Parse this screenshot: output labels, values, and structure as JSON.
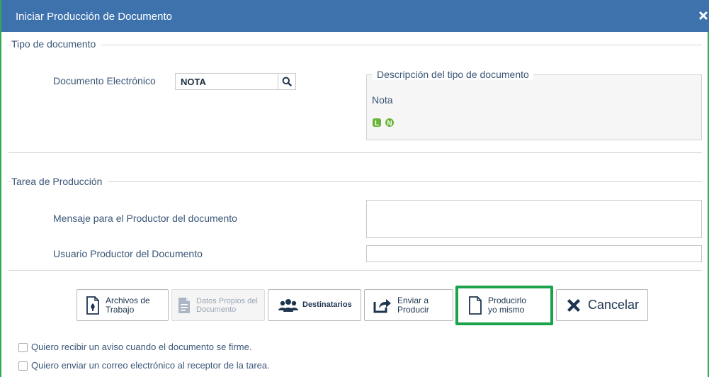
{
  "dialog": {
    "title": "Iniciar Producción de Documento",
    "close_icon": "close-icon"
  },
  "tipo_section": {
    "legend": "Tipo de documento",
    "doc_label": "Documento Electrónico",
    "doc_value": "NOTA",
    "search_icon": "search-icon",
    "desc_legend": "Descripción del tipo de documento",
    "desc_value": "Nota",
    "icons": [
      "libre-icon",
      "numerado-icon"
    ]
  },
  "tarea_section": {
    "legend": "Tarea de Producción",
    "mensaje_label": "Mensaje para el Productor del documento",
    "mensaje_value": "",
    "usuario_label": "Usuario Productor del Documento",
    "usuario_value": ""
  },
  "buttons": {
    "archivos_line1": "Archivos de",
    "archivos_line2": "Trabajo",
    "datos_line1": "Datos Propios del",
    "datos_line2": "Documento",
    "destinatarios": "Destinatarios",
    "enviar_line1": "Enviar a",
    "enviar_line2": "Producir",
    "producirlo_line1": "Producirlo",
    "producirlo_line2": "yo mismo",
    "cancelar": "Cancelar"
  },
  "options": {
    "aviso_firma": "Quiero recibir un aviso cuando el documento se firme.",
    "correo_receptor": "Quiero enviar un correo electrónico al receptor de la tarea."
  },
  "colors": {
    "titlebar": "#3d72ad",
    "highlight": "#1aa34a",
    "icon_green": "#4caf50",
    "icon_blue": "#1e3550"
  }
}
